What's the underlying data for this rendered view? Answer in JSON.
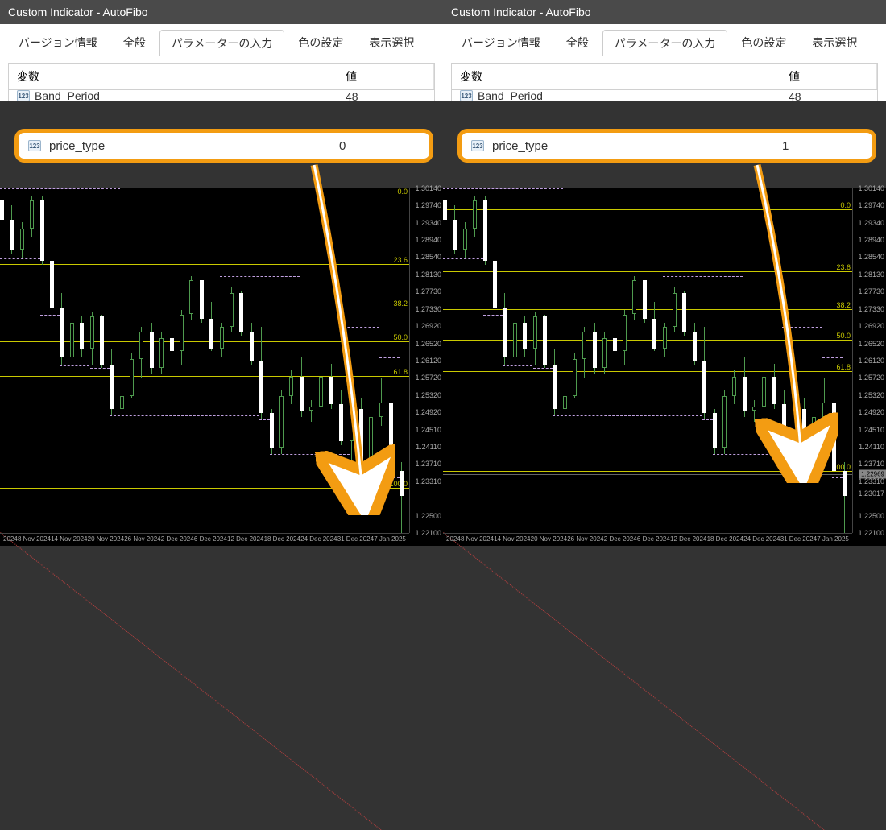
{
  "panels": [
    {
      "title": "Custom Indicator - AutoFibo",
      "tabs": [
        "バージョン情報",
        "全般",
        "パラメーターの入力",
        "色の設定",
        "表示選択"
      ],
      "active_tab": 2,
      "col_var": "変数",
      "col_val": "値",
      "partial_row_var": "Band_Period",
      "partial_row_val": "48",
      "highlight_var": "price_type",
      "highlight_val": "0"
    },
    {
      "title": "Custom Indicator - AutoFibo",
      "tabs": [
        "バージョン情報",
        "全般",
        "パラメーターの入力",
        "色の設定",
        "表示選択"
      ],
      "active_tab": 2,
      "col_var": "変数",
      "col_val": "値",
      "partial_row_var": "Band_Period",
      "partial_row_val": "48",
      "highlight_var": "price_type",
      "highlight_val": "1"
    }
  ],
  "chart_left": {
    "price_ticks": [
      "1.30140",
      "1.29740",
      "1.29340",
      "1.28940",
      "1.28540",
      "1.28130",
      "1.27730",
      "1.27330",
      "1.26920",
      "1.26520",
      "1.26120",
      "1.25720",
      "1.25320",
      "1.24920",
      "1.24510",
      "1.24110",
      "1.23710",
      "1.23310",
      "",
      "1.22500",
      "1.22100"
    ],
    "time_ticks": [
      "2024",
      "8 Nov 2024",
      "14 Nov 2024",
      "20 Nov 2024",
      "26 Nov 2024",
      "2 Dec 2024",
      "6 Dec 2024",
      "12 Dec 2024",
      "18 Dec 2024",
      "24 Dec 2024",
      "31 Dec 2024",
      "7 Jan 2025"
    ],
    "fibo_lines": [
      {
        "label": "0.0",
        "pct": 2
      },
      {
        "label": "23.6",
        "pct": 22
      },
      {
        "label": "38.2",
        "pct": 34.5
      },
      {
        "label": "50.0",
        "pct": 44.5
      },
      {
        "label": "61.8",
        "pct": 54.5
      },
      {
        "label": "100.0",
        "pct": 87
      }
    ],
    "bid": "",
    "bid_pct": null
  },
  "chart_right": {
    "price_ticks": [
      "1.30140",
      "1.29740",
      "1.29340",
      "1.28940",
      "1.28540",
      "1.28130",
      "1.27730",
      "1.27330",
      "1.26920",
      "1.26520",
      "1.26120",
      "1.25720",
      "1.25320",
      "1.24920",
      "1.24510",
      "1.24110",
      "1.23710",
      "1.23310",
      "1.23017",
      "1.22500",
      "1.22100"
    ],
    "time_ticks": [
      "2024",
      "8 Nov 2024",
      "14 Nov 2024",
      "20 Nov 2024",
      "26 Nov 2024",
      "2 Dec 2024",
      "6 Dec 2024",
      "12 Dec 2024",
      "18 Dec 2024",
      "24 Dec 2024",
      "31 Dec 2024",
      "7 Jan 2025"
    ],
    "fibo_lines": [
      {
        "label": "0.0",
        "pct": 6
      },
      {
        "label": "23.6",
        "pct": 24
      },
      {
        "label": "38.2",
        "pct": 35
      },
      {
        "label": "50.0",
        "pct": 44
      },
      {
        "label": "61.8",
        "pct": 53
      },
      {
        "label": "100.0",
        "pct": 82
      }
    ],
    "bid": "1.22969",
    "bid_pct": 83
  },
  "icon_label": "123",
  "chart_data": {
    "type": "candlestick",
    "instrument": "",
    "timeframe": "",
    "x_dates": [
      "2024",
      "8 Nov 2024",
      "14 Nov 2024",
      "20 Nov 2024",
      "26 Nov 2024",
      "2 Dec 2024",
      "6 Dec 2024",
      "12 Dec 2024",
      "18 Dec 2024",
      "24 Dec 2024",
      "31 Dec 2024",
      "7 Jan 2025"
    ],
    "y_range": [
      1.221,
      1.3014
    ],
    "candles": [
      {
        "o": 1.2985,
        "h": 1.3014,
        "l": 1.293,
        "c": 1.294
      },
      {
        "o": 1.294,
        "h": 1.2975,
        "l": 1.286,
        "c": 1.287
      },
      {
        "o": 1.2872,
        "h": 1.2935,
        "l": 1.285,
        "c": 1.292
      },
      {
        "o": 1.292,
        "h": 1.2995,
        "l": 1.29,
        "c": 1.2985
      },
      {
        "o": 1.2985,
        "h": 1.2998,
        "l": 1.2835,
        "c": 1.2845
      },
      {
        "o": 1.2845,
        "h": 1.288,
        "l": 1.272,
        "c": 1.2735
      },
      {
        "o": 1.2735,
        "h": 1.277,
        "l": 1.26,
        "c": 1.262
      },
      {
        "o": 1.262,
        "h": 1.272,
        "l": 1.26,
        "c": 1.27
      },
      {
        "o": 1.27,
        "h": 1.2715,
        "l": 1.262,
        "c": 1.264
      },
      {
        "o": 1.264,
        "h": 1.2725,
        "l": 1.26,
        "c": 1.2715
      },
      {
        "o": 1.2715,
        "h": 1.272,
        "l": 1.2595,
        "c": 1.26
      },
      {
        "o": 1.26,
        "h": 1.264,
        "l": 1.2485,
        "c": 1.25
      },
      {
        "o": 1.25,
        "h": 1.254,
        "l": 1.249,
        "c": 1.253
      },
      {
        "o": 1.253,
        "h": 1.263,
        "l": 1.2525,
        "c": 1.2615
      },
      {
        "o": 1.2615,
        "h": 1.269,
        "l": 1.257,
        "c": 1.268
      },
      {
        "o": 1.268,
        "h": 1.27,
        "l": 1.258,
        "c": 1.2595
      },
      {
        "o": 1.2595,
        "h": 1.268,
        "l": 1.258,
        "c": 1.2665
      },
      {
        "o": 1.2665,
        "h": 1.2715,
        "l": 1.262,
        "c": 1.2635
      },
      {
        "o": 1.2635,
        "h": 1.273,
        "l": 1.26,
        "c": 1.272
      },
      {
        "o": 1.272,
        "h": 1.281,
        "l": 1.2705,
        "c": 1.28
      },
      {
        "o": 1.28,
        "h": 1.28,
        "l": 1.27,
        "c": 1.271
      },
      {
        "o": 1.271,
        "h": 1.275,
        "l": 1.2635,
        "c": 1.264
      },
      {
        "o": 1.264,
        "h": 1.27,
        "l": 1.262,
        "c": 1.269
      },
      {
        "o": 1.269,
        "h": 1.2785,
        "l": 1.268,
        "c": 1.277
      },
      {
        "o": 1.277,
        "h": 1.2775,
        "l": 1.267,
        "c": 1.268
      },
      {
        "o": 1.268,
        "h": 1.27,
        "l": 1.26,
        "c": 1.261
      },
      {
        "o": 1.261,
        "h": 1.269,
        "l": 1.2475,
        "c": 1.249
      },
      {
        "o": 1.249,
        "h": 1.25,
        "l": 1.2395,
        "c": 1.241
      },
      {
        "o": 1.241,
        "h": 1.2545,
        "l": 1.2395,
        "c": 1.253
      },
      {
        "o": 1.253,
        "h": 1.259,
        "l": 1.251,
        "c": 1.2575
      },
      {
        "o": 1.2575,
        "h": 1.262,
        "l": 1.248,
        "c": 1.2495
      },
      {
        "o": 1.2495,
        "h": 1.252,
        "l": 1.247,
        "c": 1.2505
      },
      {
        "o": 1.2505,
        "h": 1.2585,
        "l": 1.249,
        "c": 1.2575
      },
      {
        "o": 1.2575,
        "h": 1.2605,
        "l": 1.25,
        "c": 1.251
      },
      {
        "o": 1.251,
        "h": 1.2545,
        "l": 1.2415,
        "c": 1.2425
      },
      {
        "o": 1.2425,
        "h": 1.251,
        "l": 1.2355,
        "c": 1.25
      },
      {
        "o": 1.25,
        "h": 1.2525,
        "l": 1.235,
        "c": 1.2365
      },
      {
        "o": 1.2365,
        "h": 1.2495,
        "l": 1.235,
        "c": 1.248
      },
      {
        "o": 1.248,
        "h": 1.257,
        "l": 1.246,
        "c": 1.2515
      },
      {
        "o": 1.2515,
        "h": 1.252,
        "l": 1.234,
        "c": 1.2355
      },
      {
        "o": 1.2355,
        "h": 1.2375,
        "l": 1.221,
        "c": 1.2297
      }
    ],
    "upper_band": [
      1.3014,
      1.3014,
      1.3014,
      1.3014,
      1.3014,
      1.3014,
      1.3014,
      1.3014,
      1.3014,
      1.3014,
      1.3014,
      1.3014,
      1.2998,
      1.2998,
      1.2998,
      1.2998,
      1.2998,
      1.2998,
      1.2998,
      1.2998,
      1.2998,
      1.2998,
      1.281,
      1.281,
      1.281,
      1.281,
      1.281,
      1.281,
      1.281,
      1.281,
      1.2785,
      1.2785,
      1.2785,
      1.2785,
      1.269,
      1.269,
      1.269,
      1.269,
      1.262,
      1.262,
      1.262
    ],
    "lower_band": [
      1.285,
      1.285,
      1.285,
      1.285,
      1.272,
      1.272,
      1.26,
      1.26,
      1.26,
      1.2595,
      1.2595,
      1.2485,
      1.2485,
      1.2485,
      1.2485,
      1.2485,
      1.2485,
      1.2485,
      1.2485,
      1.2485,
      1.2485,
      1.2485,
      1.2485,
      1.2485,
      1.2485,
      1.2485,
      1.2475,
      1.2395,
      1.2395,
      1.2395,
      1.2395,
      1.2395,
      1.2395,
      1.2395,
      1.2395,
      1.2355,
      1.235,
      1.235,
      1.235,
      1.234,
      1.221
    ],
    "fibo_left": {
      "0.0": 1.3014,
      "23.6": 1.2822,
      "38.2": 1.2704,
      "50.0": 1.2608,
      "61.8": 1.2513,
      "100.0": 1.2203
    },
    "fibo_right": {
      "0.0": 1.2968,
      "23.6": 1.282,
      "38.2": 1.2728,
      "50.0": 1.2654,
      "61.8": 1.258,
      "100.0": 1.234
    }
  }
}
